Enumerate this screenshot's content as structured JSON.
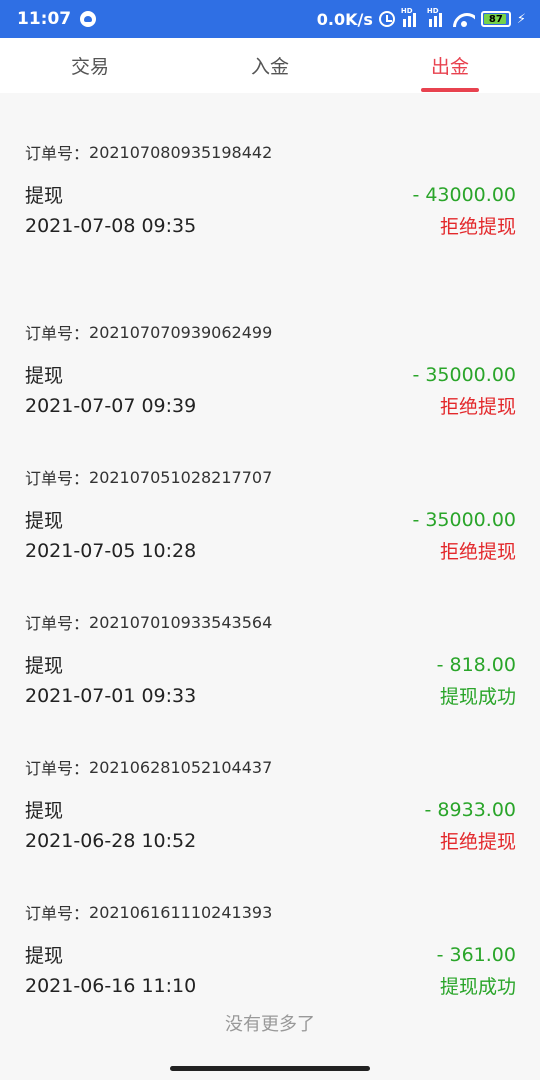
{
  "status_bar": {
    "time": "11:07",
    "network_speed": "0.0K/s",
    "battery_level": "87",
    "battery_fraction": 0.87,
    "signal_label": "HD"
  },
  "tabs": [
    {
      "label": "交易",
      "active": false
    },
    {
      "label": "入金",
      "active": false
    },
    {
      "label": "出金",
      "active": true
    }
  ],
  "records": [
    {
      "order_label": "订单号：",
      "order_no": "202107080935198442",
      "type": "提现",
      "datetime": "2021-07-08 09:35",
      "amount": "- 43000.00",
      "status": "拒绝提现",
      "status_kind": "reject"
    },
    {
      "order_label": "订单号：",
      "order_no": "202107070939062499",
      "type": "提现",
      "datetime": "2021-07-07 09:39",
      "amount": "- 35000.00",
      "status": "拒绝提现",
      "status_kind": "reject"
    },
    {
      "order_label": "订单号：",
      "order_no": "202107051028217707",
      "type": "提现",
      "datetime": "2021-07-05 10:28",
      "amount": "- 35000.00",
      "status": "拒绝提现",
      "status_kind": "reject"
    },
    {
      "order_label": "订单号：",
      "order_no": "202107010933543564",
      "type": "提现",
      "datetime": "2021-07-01 09:33",
      "amount": "- 818.00",
      "status": "提现成功",
      "status_kind": "ok"
    },
    {
      "order_label": "订单号：",
      "order_no": "202106281052104437",
      "type": "提现",
      "datetime": "2021-06-28 10:52",
      "amount": "- 8933.00",
      "status": "拒绝提现",
      "status_kind": "reject"
    },
    {
      "order_label": "订单号：",
      "order_no": "202106161110241393",
      "type": "提现",
      "datetime": "2021-06-16 11:10",
      "amount": "- 361.00",
      "status": "提现成功",
      "status_kind": "ok"
    }
  ],
  "footer": {
    "no_more": "没有更多了"
  },
  "colors": {
    "status_bar": "#2f6fe4",
    "accent": "#e8424f",
    "amount": "#2aa52a",
    "reject": "#e3282b",
    "success": "#2aa52a"
  }
}
